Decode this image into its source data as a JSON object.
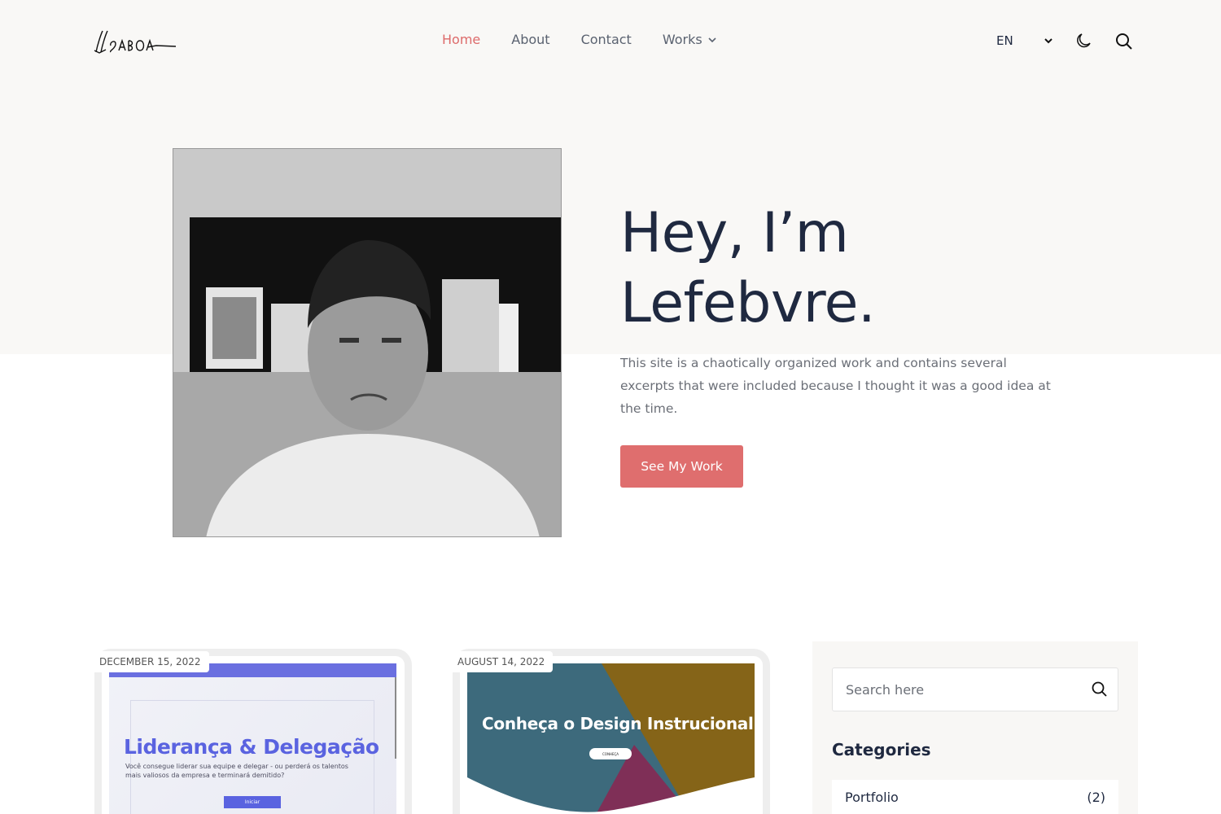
{
  "header": {
    "logo_text": "Ill SABOA",
    "nav": [
      {
        "label": "Home",
        "active": true
      },
      {
        "label": "About",
        "active": false
      },
      {
        "label": "Contact",
        "active": false
      },
      {
        "label": "Works",
        "active": false,
        "has_dropdown": true
      }
    ],
    "language": "EN",
    "icons": [
      "chevron-down-icon",
      "moon-icon",
      "search-icon"
    ]
  },
  "hero": {
    "title_line1": "Hey, I’m",
    "title_line2": "Lefebvre.",
    "text": "This site is a chaotically organized work and contains several excerpts that were included because I thought it was a good idea at the time.",
    "button_label": "See My Work",
    "accent_color": "#df6e6e"
  },
  "posts": [
    {
      "date": "DECEMBER 15, 2022",
      "thumb_title": "Liderança & Delegação",
      "thumb_text": "Você consegue liderar sua equipe e delegar - ou perderá os talentos mais valiosos da empresa e terminará demitido?",
      "thumb_button": "Iniciar"
    },
    {
      "date": "AUGUST 14, 2022",
      "thumb_title": "Conheça o Design Instrucional",
      "thumb_button": "CONHEÇA"
    }
  ],
  "sidebar": {
    "search_placeholder": "Search here",
    "categories_title": "Categories",
    "categories": [
      {
        "name": "Portfolio",
        "count": "(2)"
      }
    ]
  }
}
